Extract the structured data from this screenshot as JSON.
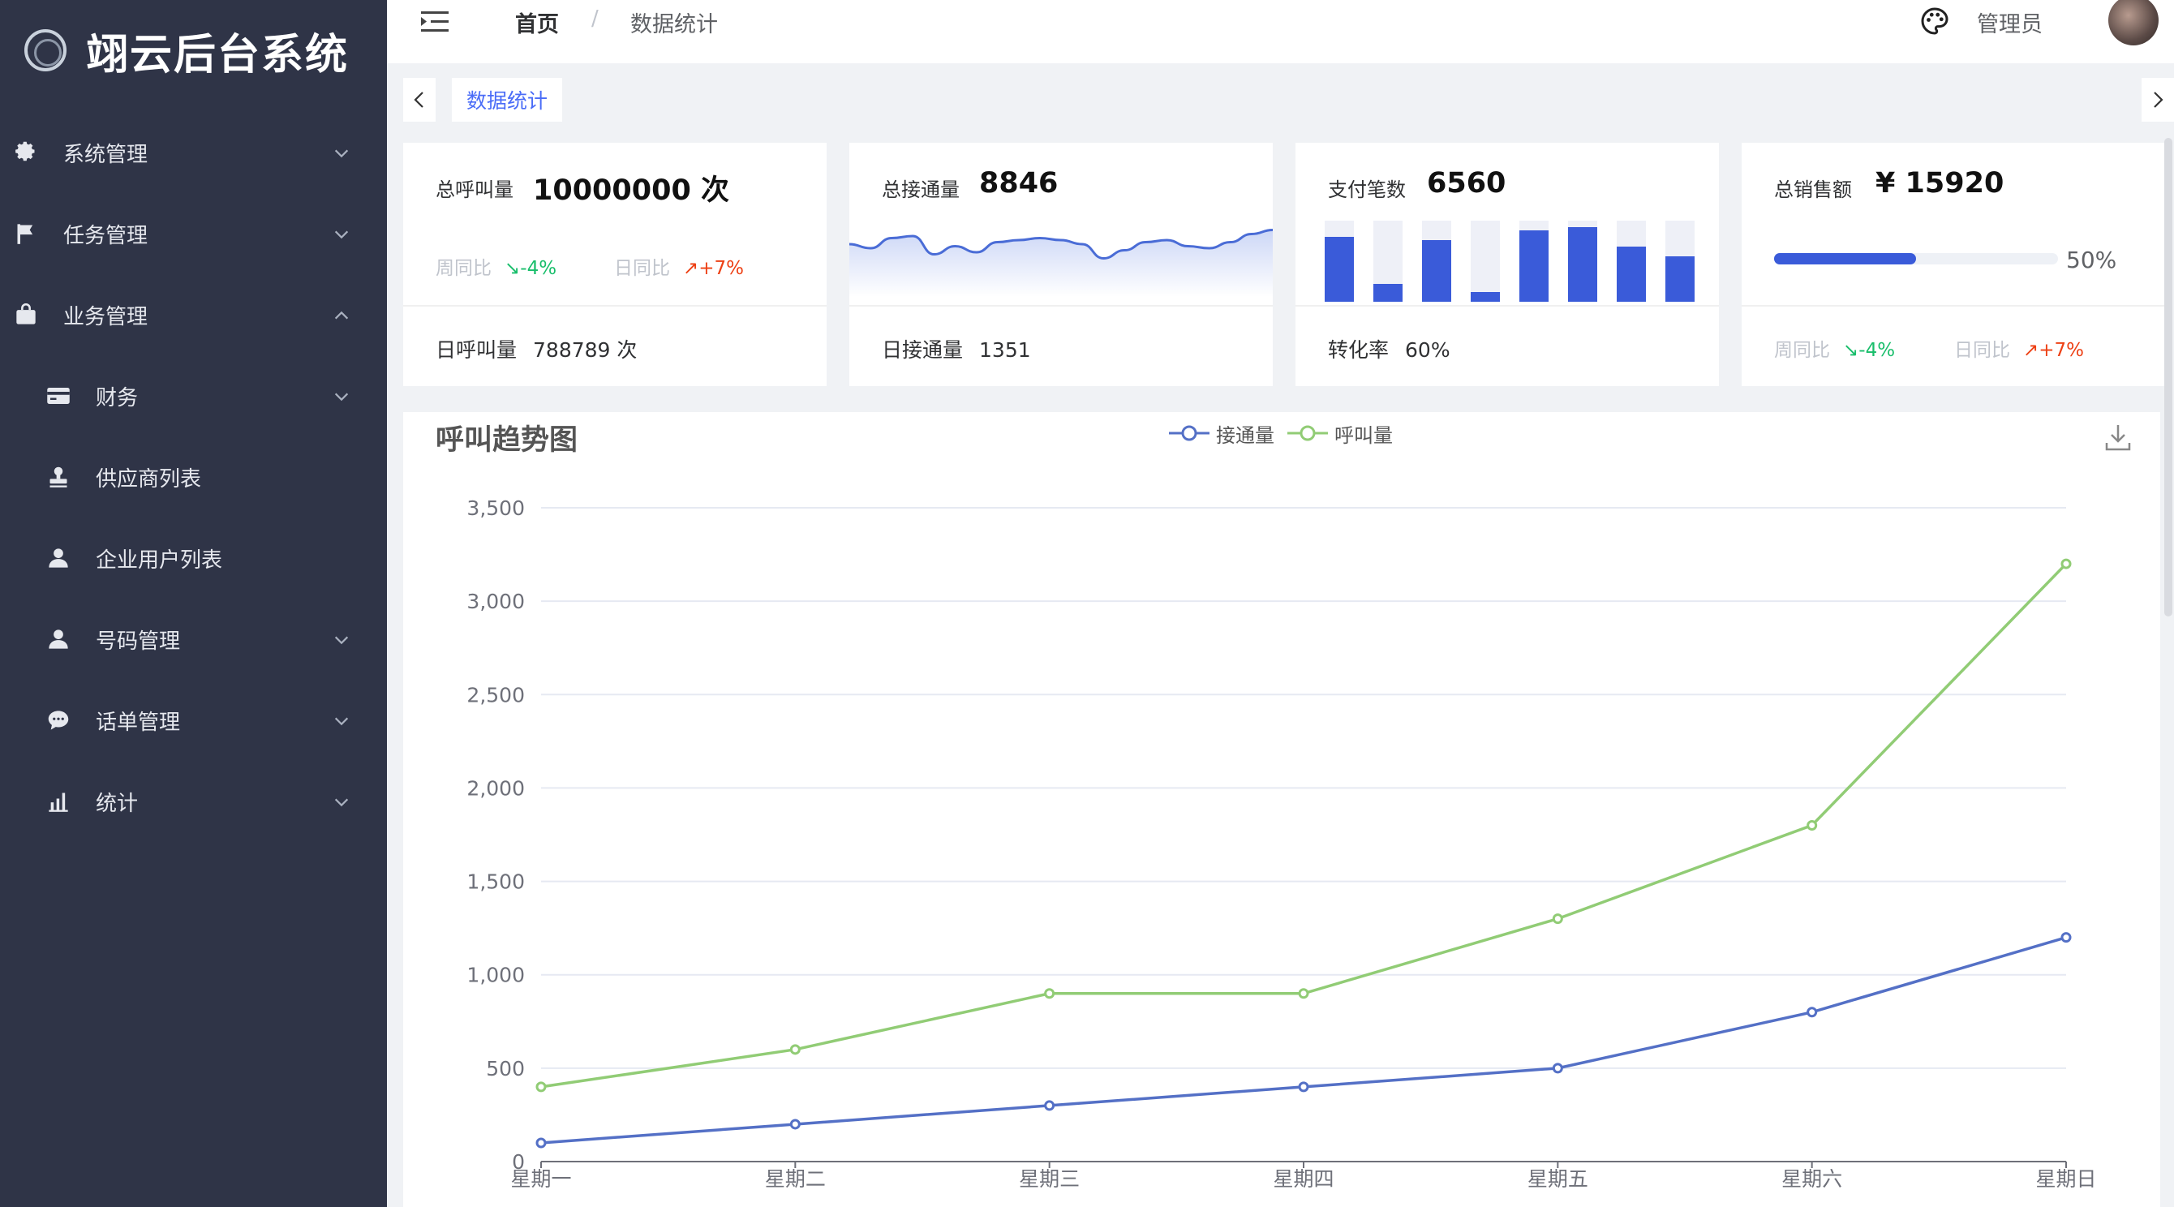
{
  "app": {
    "title": "翊云后台系统"
  },
  "sidebar": {
    "items": [
      {
        "label": "系统管理",
        "icon": "gear-icon",
        "level": 1,
        "expanded": false,
        "hasChildren": true
      },
      {
        "label": "任务管理",
        "icon": "flag-icon",
        "level": 1,
        "expanded": false,
        "hasChildren": true
      },
      {
        "label": "业务管理",
        "icon": "bag-icon",
        "level": 1,
        "expanded": true,
        "hasChildren": true
      },
      {
        "label": "财务",
        "icon": "card-icon",
        "level": 2,
        "expanded": false,
        "hasChildren": true
      },
      {
        "label": "供应商列表",
        "icon": "stamp-icon",
        "level": 2,
        "hasChildren": false
      },
      {
        "label": "企业用户列表",
        "icon": "user-icon",
        "level": 2,
        "hasChildren": false
      },
      {
        "label": "号码管理",
        "icon": "user-icon",
        "level": 2,
        "expanded": false,
        "hasChildren": true
      },
      {
        "label": "话单管理",
        "icon": "chat-icon",
        "level": 2,
        "expanded": false,
        "hasChildren": true
      },
      {
        "label": "统计",
        "icon": "bar-chart-icon",
        "level": 2,
        "expanded": false,
        "hasChildren": true
      }
    ]
  },
  "header": {
    "breadcrumb_home": "首页",
    "breadcrumb_sep": "/",
    "breadcrumb_current": "数据统计",
    "username": "管理员"
  },
  "tabs": [
    {
      "label": "数据统计",
      "active": true
    }
  ],
  "cards": {
    "calls": {
      "title": "总呼叫量",
      "value": "10000000 次",
      "week_label": "周同比",
      "week_value": "↘-4%",
      "day_label": "日同比",
      "day_value": "↗+7%",
      "foot_label": "日呼叫量",
      "foot_value": "788789 次"
    },
    "connected": {
      "title": "总接通量",
      "value": "8846",
      "foot_label": "日接通量",
      "foot_value": "1351",
      "sparkline": [
        52,
        48,
        58,
        60,
        42,
        50,
        44,
        54,
        56,
        58,
        56,
        52,
        38,
        46,
        54,
        56,
        50,
        48,
        54,
        62,
        66
      ]
    },
    "payments": {
      "title": "支付笔数",
      "value": "6560",
      "foot_label": "转化率",
      "foot_value": "60%",
      "bars": [
        0.8,
        0.22,
        0.76,
        0.12,
        0.88,
        0.92,
        0.68,
        0.56
      ]
    },
    "sales": {
      "title": "总销售额",
      "value": "¥ 15920",
      "progress": 0.5,
      "progress_label": "50%",
      "week_label": "周同比",
      "week_value": "↘-4%",
      "day_label": "日同比",
      "day_value": "↗+7%"
    }
  },
  "chart_data": {
    "type": "line",
    "title": "呼叫趋势图",
    "categories": [
      "星期一",
      "星期二",
      "星期三",
      "星期四",
      "星期五",
      "星期六",
      "星期日"
    ],
    "series": [
      {
        "name": "接通量",
        "color": "#5470c6",
        "values": [
          100,
          200,
          300,
          400,
          500,
          800,
          1200
        ]
      },
      {
        "name": "呼叫量",
        "color": "#91cc75",
        "values": [
          400,
          600,
          900,
          900,
          1300,
          1800,
          3200
        ]
      }
    ],
    "yticks": [
      "0",
      "500",
      "1,000",
      "1,500",
      "2,000",
      "2,500",
      "3,000",
      "3,500"
    ],
    "ylim": [
      0,
      3500
    ],
    "grid": true,
    "legend": "top-center"
  },
  "colors": {
    "sidebar_bg": "#2f3447",
    "accent": "#4a6cf7",
    "up": "#ed4014",
    "down": "#19be6b"
  }
}
